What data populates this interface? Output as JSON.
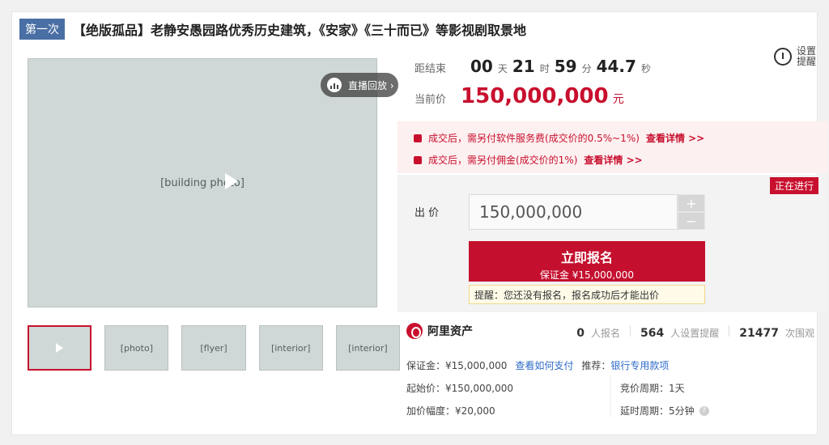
{
  "header": {
    "badge": "第一次",
    "title": "【绝版孤品】老静安愚园路优秀历史建筑，《安家》《三十而已》等影视剧取景地"
  },
  "media": {
    "main_image": "[building photo]",
    "replay_label": "直播回放 ›",
    "thumbnails": [
      {
        "label": "[photo]",
        "active": true,
        "video": true
      },
      {
        "label": "[photo]",
        "active": false
      },
      {
        "label": "[flyer]",
        "active": false
      },
      {
        "label": "[interior]",
        "active": false
      },
      {
        "label": "[interior]",
        "active": false
      }
    ]
  },
  "countdown": {
    "label": "距结束",
    "days": "00",
    "days_unit": "天",
    "hours": "21",
    "hours_unit": "时",
    "minutes": "59",
    "minutes_unit": "分",
    "seconds": "44.7",
    "seconds_unit": "秒"
  },
  "remind": {
    "label": "设置提醒"
  },
  "current_price": {
    "label": "当前价",
    "value": "150,000,000",
    "unit": "元"
  },
  "fees": [
    {
      "text": "成交后，需另付软件服务费(成交价的0.5%~1%)",
      "link": "查看详情 >>"
    },
    {
      "text": "成交后，需另付佣金(成交价的1%)",
      "link": "查看详情 >>"
    }
  ],
  "status": "正在进行",
  "bid": {
    "label": "出  价",
    "value": "150,000,000",
    "plus": "+",
    "minus": "−"
  },
  "signup": {
    "main": "立即报名",
    "sub": "保证金 ¥15,000,000"
  },
  "tip": "提醒：您还没有报名，报名成功后才能出价",
  "brand": {
    "name": "阿里资产"
  },
  "stats": [
    {
      "n": "0",
      "t": "人报名"
    },
    {
      "n": "564",
      "t": "人设置提醒"
    },
    {
      "n": "21477",
      "t": "次围观"
    }
  ],
  "info": {
    "deposit": "保证金：¥15,000,000",
    "how_pay": "查看如何支付",
    "recommend_label": "推荐：",
    "recommend_link": "银行专用款项",
    "start_price": "起始价：¥150,000,000",
    "increment": "加价幅度：¥20,000",
    "cycle": "竞价周期：1天",
    "delay": "延时周期：5分钟"
  },
  "colors": {
    "accent": "#c8102e",
    "link": "#2e6bc8",
    "badge": "#4a6fa5"
  }
}
